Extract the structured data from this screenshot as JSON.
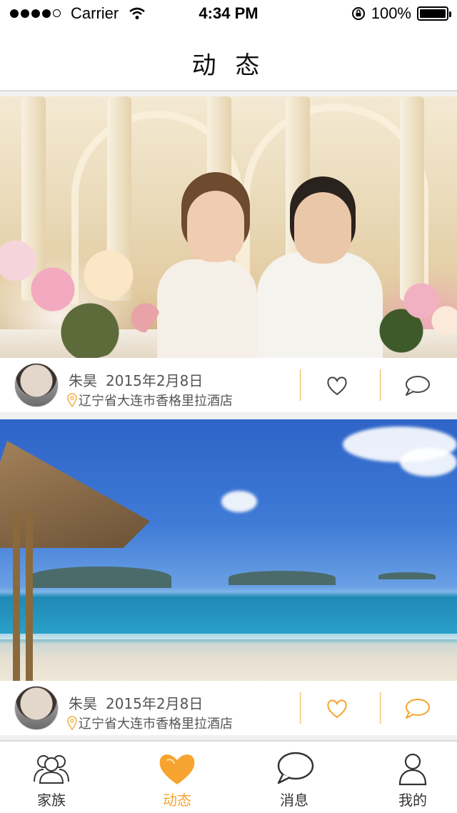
{
  "status_bar": {
    "carrier": "Carrier",
    "time": "4:34 PM",
    "battery": "100%"
  },
  "nav": {
    "title": "动 态"
  },
  "posts": [
    {
      "author": "朱昊",
      "date": "2015年2月8日",
      "location": "辽宁省大连市香格里拉酒店",
      "image": "wedding-couple-photo",
      "liked": false
    },
    {
      "author": "朱昊",
      "date": "2015年2月8日",
      "location": "辽宁省大连市香格里拉酒店",
      "image": "beach-photo",
      "liked": true
    }
  ],
  "tabs": [
    {
      "label": "家族",
      "icon": "family-icon",
      "active": false
    },
    {
      "label": "动态",
      "icon": "heart-icon",
      "active": true
    },
    {
      "label": "消息",
      "icon": "message-icon",
      "active": false
    },
    {
      "label": "我的",
      "icon": "profile-icon",
      "active": false
    }
  ],
  "colors": {
    "accent": "#f7a32f",
    "divider": "#f2b24c",
    "text": "#555555"
  }
}
